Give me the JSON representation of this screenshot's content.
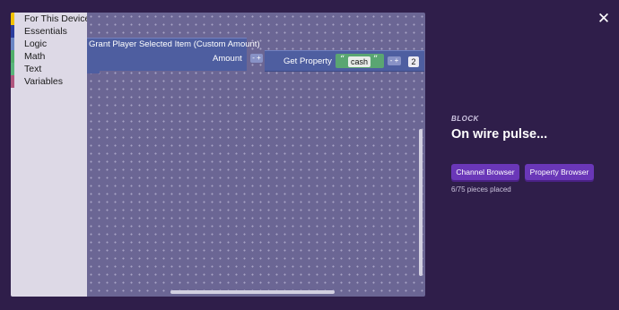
{
  "toolbox": {
    "categories": [
      {
        "label": "For This Device",
        "color": "#f2c200"
      },
      {
        "label": "Essentials",
        "color": "#2b3d9e"
      },
      {
        "label": "Logic",
        "color": "#6b86c4"
      },
      {
        "label": "Math",
        "color": "#4fae6a"
      },
      {
        "label": "Text",
        "color": "#58b57a"
      },
      {
        "label": "Variables",
        "color": "#b0567e"
      }
    ]
  },
  "workspace": {
    "block_title": "Grant Player Selected Item (Custom Amount)",
    "amount_label": "Amount",
    "get_property_label": "Get Property",
    "string_value": "cash",
    "open_quote": "“",
    "close_quote": "”",
    "number_value": "2",
    "minus_plus": "- +",
    "trash_icon": "trash-icon"
  },
  "panel": {
    "close_icon": "✕",
    "label": "BLOCK",
    "title": "On wire pulse...",
    "channel_browser": "Channel Browser",
    "property_browser": "Property Browser",
    "pieces_placed": "6/75 pieces placed"
  },
  "colors": {
    "background": "#2f1e4a",
    "workspace": "#6b6694",
    "block": "#4e5ea0",
    "string_block": "#5aa672",
    "button": "#6a37b8"
  }
}
